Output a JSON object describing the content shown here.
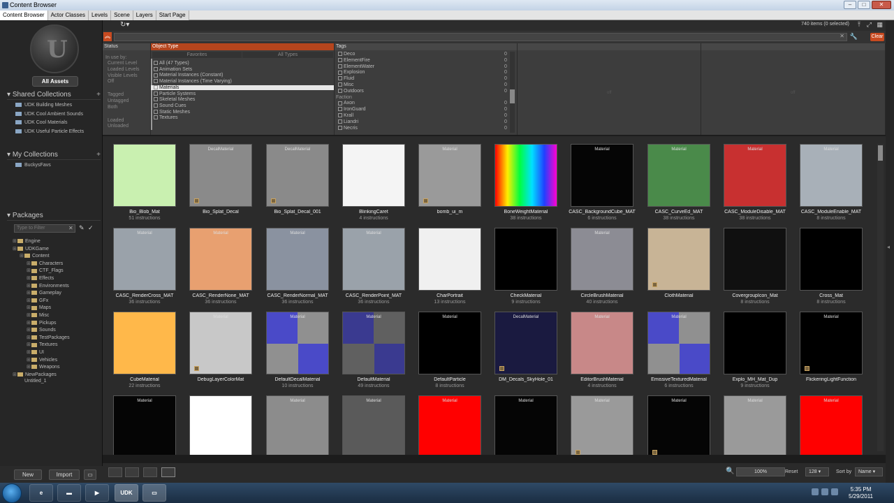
{
  "window": {
    "title": "Content Browser"
  },
  "tabs": [
    "Content Browser",
    "Actor Classes",
    "Levels",
    "Scene",
    "Layers",
    "Start Page"
  ],
  "left": {
    "all_assets": "All Assets",
    "shared_collections": "Shared Collections",
    "shared_items": [
      "UDK Building Meshes",
      "UDK Cool Ambient Sounds",
      "UDK Cool Materials",
      "UDK Useful Particle Effects"
    ],
    "my_collections": "My Collections",
    "my_items": [
      "BuckysFavs"
    ],
    "packages": "Packages",
    "filter_placeholder": "Type to Filter",
    "tree": [
      {
        "label": "Engine",
        "level": 0,
        "folder": true
      },
      {
        "label": "UDKGame",
        "level": 0,
        "folder": true
      },
      {
        "label": "Content",
        "level": 1,
        "folder": true
      },
      {
        "label": "Characters",
        "level": 2,
        "folder": true
      },
      {
        "label": "CTF_Flags",
        "level": 2,
        "folder": true
      },
      {
        "label": "Effects",
        "level": 2,
        "folder": true
      },
      {
        "label": "Environments",
        "level": 2,
        "folder": true
      },
      {
        "label": "Gameplay",
        "level": 2,
        "folder": true
      },
      {
        "label": "GFx",
        "level": 2,
        "folder": true
      },
      {
        "label": "Maps",
        "level": 2,
        "folder": true
      },
      {
        "label": "Misc",
        "level": 2,
        "folder": true
      },
      {
        "label": "Pickups",
        "level": 2,
        "folder": true
      },
      {
        "label": "Sounds",
        "level": 2,
        "folder": true
      },
      {
        "label": "TestPackages",
        "level": 2,
        "folder": true
      },
      {
        "label": "Textures",
        "level": 2,
        "folder": true
      },
      {
        "label": "UI",
        "level": 2,
        "folder": true
      },
      {
        "label": "Vehicles",
        "level": 2,
        "folder": true
      },
      {
        "label": "Weapons",
        "level": 2,
        "folder": true
      },
      {
        "label": "NewPackages",
        "level": 0,
        "folder": true
      },
      {
        "label": "Untitled_1",
        "level": 1,
        "folder": false
      }
    ],
    "new_label": "New",
    "import_label": "Import"
  },
  "toolbar": {
    "count": "740 items (0 selected)",
    "clear": "Clear"
  },
  "filters": {
    "status_head": "Status",
    "status_items": [
      "In use by:",
      "Current Level",
      "Loaded Levels",
      "Visible Levels",
      "Off",
      "Tagged",
      "Untagged",
      "Both",
      "Loaded",
      "Unloaded"
    ],
    "type_head": "Object Type",
    "type_tabs": [
      "Favorites",
      "All Types"
    ],
    "type_items": [
      "All (47 Types)",
      "Animation Sets",
      "Material Instances (Constant)",
      "Material Instances (Time Varying)",
      "Materials",
      "Particle Systems",
      "Skeletal Meshes",
      "Sound Cues",
      "Static Meshes",
      "Textures"
    ],
    "selected_type": "Materials",
    "tags_head": "Tags",
    "tags": [
      {
        "label": "Deco",
        "count": "0"
      },
      {
        "label": "ElementFire",
        "count": "0"
      },
      {
        "label": "ElementWater",
        "count": "0"
      },
      {
        "label": "Explosion",
        "count": "0"
      },
      {
        "label": "Fluid",
        "count": "0"
      },
      {
        "label": "Misc",
        "count": "0"
      },
      {
        "label": "Outdoors",
        "count": "0"
      },
      {
        "label": "Faction",
        "count": "",
        "group": true
      },
      {
        "label": "Axon",
        "count": "0"
      },
      {
        "label": "IronGuard",
        "count": "0"
      },
      {
        "label": "Krall",
        "count": "0"
      },
      {
        "label": "Liandri",
        "count": "0"
      },
      {
        "label": "Necris",
        "count": "0"
      }
    ],
    "empty1": "off",
    "empty2": "off"
  },
  "assets": [
    {
      "name": "Bio_Blob_Mat",
      "info": "51 instructions",
      "type": "",
      "bg": "#c9f0b0",
      "corner": false
    },
    {
      "name": "Bio_Splat_Decal",
      "info": "",
      "type": "DecalMaterial",
      "bg": "#8a8a8a",
      "corner": true
    },
    {
      "name": "Bio_Splat_Decal_001",
      "info": "",
      "type": "DecalMaterial",
      "bg": "#8a8a8a",
      "corner": true
    },
    {
      "name": "BlinkingCaret",
      "info": "4 instructions",
      "type": "",
      "bg": "#f4f4f4",
      "corner": false
    },
    {
      "name": "bomb_ui_m",
      "info": "",
      "type": "Material",
      "bg": "#9a9a9a",
      "corner": true
    },
    {
      "name": "BoneWeightMaterial",
      "info": "38 instructions",
      "type": "",
      "bg": "rainbow",
      "corner": false
    },
    {
      "name": "CASC_BackgroundCube_MAT",
      "info": "6 instructions",
      "type": "Material",
      "bg": "#050505",
      "corner": false
    },
    {
      "name": "CASC_CurveEd_MAT",
      "info": "38 instructions",
      "type": "Material",
      "bg": "#4a8a4a",
      "corner": false
    },
    {
      "name": "CASC_ModuleDisable_MAT",
      "info": "38 instructions",
      "type": "Material",
      "bg": "#c83030",
      "corner": false
    },
    {
      "name": "CASC_ModuleEnable_MAT",
      "info": "8 instructions",
      "type": "Material",
      "bg": "#a8b0b8",
      "corner": false
    },
    {
      "name": "CASC_RenderCross_MAT",
      "info": "36 instructions",
      "type": "Material",
      "bg": "#9aa2aa",
      "corner": false
    },
    {
      "name": "CASC_RenderNone_MAT",
      "info": "36 instructions",
      "type": "Material",
      "bg": "#e8a070",
      "corner": false
    },
    {
      "name": "CASC_RenderNormal_MAT",
      "info": "36 instructions",
      "type": "Material",
      "bg": "#8a92a0",
      "corner": false
    },
    {
      "name": "CASC_RenderPoint_MAT",
      "info": "36 instructions",
      "type": "Material",
      "bg": "#9aa2aa",
      "corner": false
    },
    {
      "name": "CharPortrait",
      "info": "13 instructions",
      "type": "",
      "bg": "#f0f0f0",
      "corner": false
    },
    {
      "name": "CheckMaterial",
      "info": "9 instructions",
      "type": "",
      "bg": "#000000",
      "corner": false
    },
    {
      "name": "CircleBrushMaterial",
      "info": "40 instructions",
      "type": "Material",
      "bg": "#8c8c94",
      "corner": false
    },
    {
      "name": "ClothMaterial",
      "info": "",
      "type": "",
      "bg": "#c8b496",
      "corner": true
    },
    {
      "name": "CovergroupIcon_Mat",
      "info": "8 instructions",
      "type": "",
      "bg": "#101010",
      "corner": false
    },
    {
      "name": "Cross_Mat",
      "info": "8 instructions",
      "type": "",
      "bg": "#000000",
      "corner": false
    },
    {
      "name": "CubeMaterial",
      "info": "22 instructions",
      "type": "",
      "bg": "#ffb84a",
      "corner": false
    },
    {
      "name": "DebugLayerColorMat",
      "info": "",
      "type": "Material",
      "bg": "#c8c8c8",
      "corner": true
    },
    {
      "name": "DefaultDecalMaterial",
      "info": "10 instructions",
      "type": "Material",
      "bg": "quad-blue",
      "corner": false
    },
    {
      "name": "DefaultMaterial",
      "info": "49 instructions",
      "type": "Material",
      "bg": "quad-dblue",
      "corner": false
    },
    {
      "name": "DefaultParticle",
      "info": "8 instructions",
      "type": "Material",
      "bg": "#000000",
      "corner": false
    },
    {
      "name": "DM_Decals_SkyHole_01",
      "info": "",
      "type": "DecalMaterial",
      "bg": "#1a1a40",
      "corner": true
    },
    {
      "name": "EditorBrushMaterial",
      "info": "4 instructions",
      "type": "Material",
      "bg": "#c88888",
      "corner": false
    },
    {
      "name": "EmissiveTexturedMaterial",
      "info": "6 instructions",
      "type": "Material",
      "bg": "quad-blue",
      "corner": false
    },
    {
      "name": "Explo_MH_Mat_Dup",
      "info": "9 instructions",
      "type": "",
      "bg": "#000000",
      "corner": false
    },
    {
      "name": "FlickeringLightFunction",
      "info": "",
      "type": "Material",
      "bg": "#000000",
      "corner": true
    },
    {
      "name": "",
      "info": "",
      "type": "Material",
      "bg": "#050505",
      "corner": false
    },
    {
      "name": "",
      "info": "",
      "type": "",
      "bg": "#ffffff",
      "corner": false
    },
    {
      "name": "",
      "info": "",
      "type": "Material",
      "bg": "#8c8c8c",
      "corner": false
    },
    {
      "name": "",
      "info": "",
      "type": "Material",
      "bg": "#5a5a5a",
      "corner": false
    },
    {
      "name": "",
      "info": "",
      "type": "Material",
      "bg": "#ff0000",
      "corner": false
    },
    {
      "name": "",
      "info": "",
      "type": "Material",
      "bg": "#050505",
      "corner": false
    },
    {
      "name": "",
      "info": "",
      "type": "Material",
      "bg": "#9a9a9a",
      "corner": true
    },
    {
      "name": "",
      "info": "",
      "type": "Material",
      "bg": "#050505",
      "corner": true
    },
    {
      "name": "",
      "info": "",
      "type": "Material",
      "bg": "#9a9a9a",
      "corner": false
    },
    {
      "name": "",
      "info": "",
      "type": "Material",
      "bg": "#ff0000",
      "corner": false
    }
  ],
  "bottom": {
    "zoom": "100%",
    "reset": "Reset",
    "size": "128",
    "sort_by": "Sort by",
    "sort_value": "Name"
  },
  "taskbar": {
    "time": "5:35 PM",
    "date": "5/29/2011",
    "udk": "UDK"
  }
}
